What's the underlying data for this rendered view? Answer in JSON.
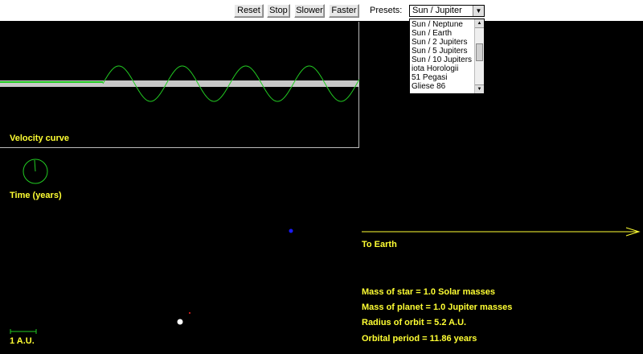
{
  "toolbar": {
    "reset_label": "Reset",
    "stop_label": "Stop",
    "slower_label": "Slower",
    "faster_label": "Faster",
    "presets_label": "Presets:",
    "preset_selected": "Sun / Jupiter"
  },
  "presets_options": [
    "Sun / Neptune",
    "Sun / Earth",
    "Sun / 2 Jupiters",
    "Sun / 5 Jupiters",
    "Sun / 10 Jupiters",
    "iota Horologii",
    "51 Pegasi",
    "Gliese 86"
  ],
  "panel": {
    "velocity_curve_label": "Velocity curve",
    "time_label": "Time (years)",
    "to_earth_label": "To Earth",
    "scale_label": "1 A.U."
  },
  "info": {
    "star_mass": "Mass of star = 1.0 Solar masses",
    "planet_mass": "Mass of planet = 1.0 Jupiter masses",
    "orbit_radius": "Radius of orbit = 5.2 A.U.",
    "orbital_period": "Orbital period = 11.86 years"
  },
  "colors": {
    "background": "#000000",
    "label": "#ffff33",
    "curve": "#22cc22",
    "band": "#c8c8c8",
    "star": "#ffffff",
    "planet": "#1a1aff",
    "star_marker": "#ff2222"
  }
}
